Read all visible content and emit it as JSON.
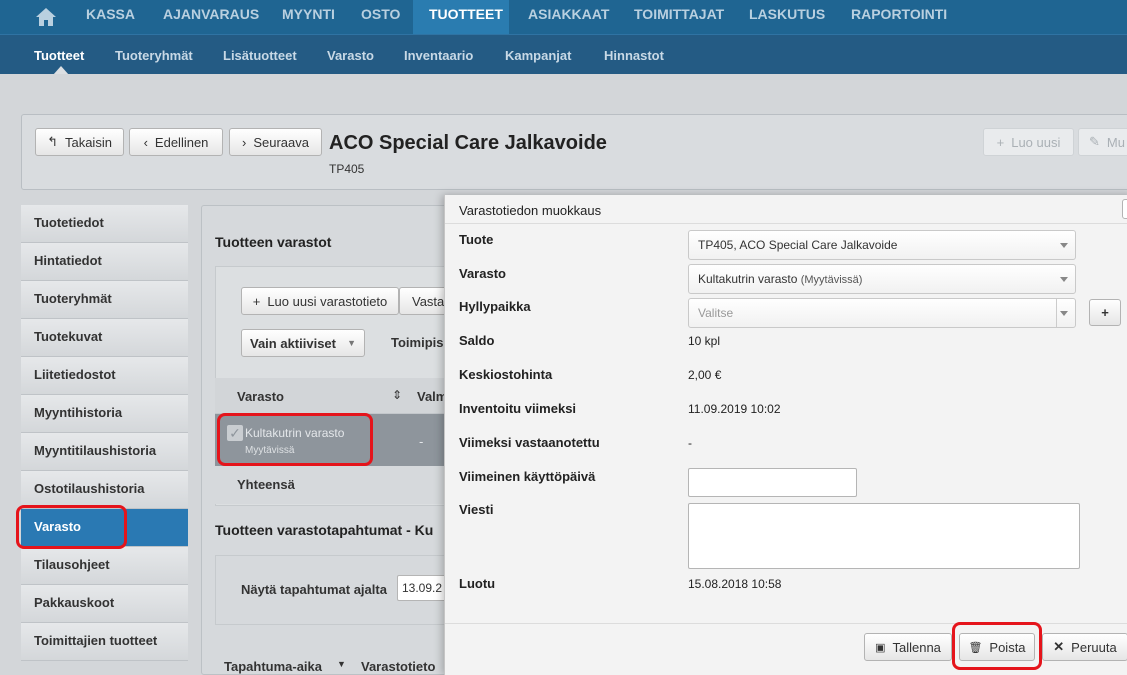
{
  "topnav": {
    "items": [
      "KASSA",
      "AJANVARAUS",
      "MYYNTI",
      "OSTO",
      "TUOTTEET",
      "ASIAKKAAT",
      "TOIMITTAJAT",
      "LASKUTUS",
      "RAPORTOINTI"
    ],
    "active": "TUOTTEET"
  },
  "subnav": {
    "items": [
      "Tuotteet",
      "Tuoteryhmät",
      "Lisätuotteet",
      "Varasto",
      "Inventaario",
      "Kampanjat",
      "Hinnastot"
    ],
    "active": "Tuotteet"
  },
  "header": {
    "back_label": "Takaisin",
    "prev_label": "Edellinen",
    "next_label": "Seuraava",
    "title": "ACO Special Care Jalkavoide",
    "code": "TP405",
    "new_label": "Luo uusi",
    "edit_label": "Mu"
  },
  "leftmenu": {
    "items": [
      "Tuotetiedot",
      "Hintatiedot",
      "Tuoteryhmät",
      "Tuotekuvat",
      "Liitetiedostot",
      "Myyntihistoria",
      "Myyntitilaushistoria",
      "Ostotilaushistoria",
      "Varasto",
      "Tilausohjeet",
      "Pakkauskoot",
      "Toimittajien tuotteet"
    ],
    "active": "Varasto"
  },
  "stock": {
    "section_title": "Tuotteen varastot",
    "new_button": "Luo uusi varastotieto",
    "second_button": "Vasta",
    "filter_select": "Vain aktiiviset",
    "toimipiste_label": "Toimipis",
    "col_varasto": "Varasto",
    "col_valm": "Valm",
    "row_name": "Kultakutrin varasto",
    "row_status": "Myytävissä",
    "row_dash": "-",
    "total_label": "Yhteensä",
    "events_title": "Tuotteen varastotapahtumat -  Ku",
    "show_events_label": "Näytä tapahtumat ajalta",
    "date_value": "13.09.2",
    "col_event_time": "Tapahtuma-aika",
    "col_event_info": "Varastotieto"
  },
  "modal": {
    "title": "Varastotiedon muokkaus",
    "fields": {
      "tuote_label": "Tuote",
      "tuote_value": "TP405, ACO Special Care Jalkavoide",
      "varasto_label": "Varasto",
      "varasto_value": "Kultakutrin varasto",
      "varasto_status": "(Myytävissä)",
      "hylly_label": "Hyllypaikka",
      "hylly_placeholder": "Valitse",
      "saldo_label": "Saldo",
      "saldo_value": "10 kpl",
      "keski_label": "Keskiostohinta",
      "keski_value": "2,00 €",
      "inventoitu_label": "Inventoitu viimeksi",
      "inventoitu_value": "11.09.2019 10:02",
      "vastaanotettu_label": "Viimeksi vastaanotettu",
      "vastaanotettu_value": "-",
      "kayttopaiva_label": "Viimeinen käyttöpäivä",
      "kayttopaiva_value": "",
      "viesti_label": "Viesti",
      "viesti_value": "",
      "luotu_label": "Luotu",
      "luotu_value": "15.08.2018 10:58"
    },
    "add_symbol": "+",
    "save_label": "Tallenna",
    "delete_label": "Poista",
    "cancel_label": "Peruuta"
  },
  "colors": {
    "topnav": "#1f6592",
    "subnav": "#245b84",
    "active_menu": "#2a79b3",
    "highlight": "#e5141b"
  }
}
